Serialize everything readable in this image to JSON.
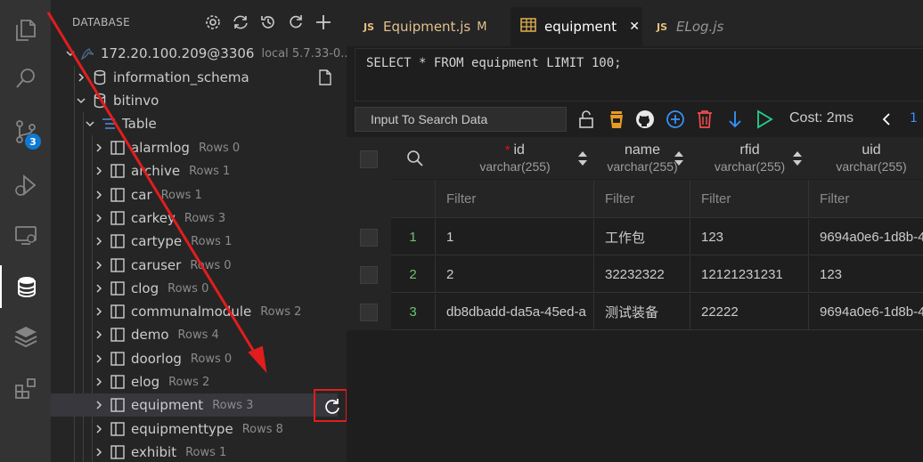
{
  "sidebar": {
    "title": "DATABASE",
    "actions": [
      "settings-icon",
      "refresh-icon",
      "history-icon",
      "reload-icon",
      "add-icon"
    ],
    "connection": {
      "label": "172.20.100.209@3306",
      "local": "local 5.7.33-0..."
    },
    "databases": [
      {
        "label": "information_schema"
      },
      {
        "label": "bitinvo"
      }
    ],
    "table_group": "Table",
    "tables": [
      {
        "name": "alarmlog",
        "rows": "Rows 0"
      },
      {
        "name": "archive",
        "rows": "Rows 1"
      },
      {
        "name": "car",
        "rows": "Rows 1"
      },
      {
        "name": "carkey",
        "rows": "Rows 3"
      },
      {
        "name": "cartype",
        "rows": "Rows 1"
      },
      {
        "name": "caruser",
        "rows": "Rows 0"
      },
      {
        "name": "clog",
        "rows": "Rows 0"
      },
      {
        "name": "communalmodule",
        "rows": "Rows 2"
      },
      {
        "name": "demo",
        "rows": "Rows 4"
      },
      {
        "name": "doorlog",
        "rows": "Rows 0"
      },
      {
        "name": "elog",
        "rows": "Rows 2"
      },
      {
        "name": "equipment",
        "rows": "Rows 3"
      },
      {
        "name": "equipmenttype",
        "rows": "Rows 8"
      },
      {
        "name": "exhibit",
        "rows": "Rows 1"
      }
    ]
  },
  "tabs": [
    {
      "badge": "JS",
      "label": "Equipment.js",
      "status": "M",
      "color": "#e2c08d"
    },
    {
      "label": "equipment",
      "close": "✕"
    },
    {
      "badge": "JS",
      "label": "ELog.js"
    }
  ],
  "query": "SELECT * FROM equipment LIMIT 100;",
  "toolbar": {
    "search_placeholder": "Input To Search Data",
    "cost": "Cost: 2ms",
    "page": "1"
  },
  "grid": {
    "columns": [
      {
        "name": "id",
        "type": "varchar(255)",
        "required": "*"
      },
      {
        "name": "name",
        "type": "varchar(255)"
      },
      {
        "name": "rfid",
        "type": "varchar(255)"
      },
      {
        "name": "uid",
        "type": "varchar(255)"
      }
    ],
    "filter_placeholder": "Filter",
    "rows": [
      {
        "num": "1",
        "cells": [
          "1",
          "工作包",
          "123",
          "9694a0e6-1d8b-4"
        ]
      },
      {
        "num": "2",
        "cells": [
          "2",
          "32232322",
          "12121231231",
          "123"
        ]
      },
      {
        "num": "3",
        "cells": [
          "db8dbadd-da5a-45ed-a",
          "测试装备",
          "22222",
          "9694a0e6-1d8b-4"
        ]
      }
    ]
  },
  "colors": {
    "accent": "#3794ff",
    "highlight": "#e11d1d",
    "row_number": "#6bc46d",
    "modified": "#e2c08d"
  }
}
